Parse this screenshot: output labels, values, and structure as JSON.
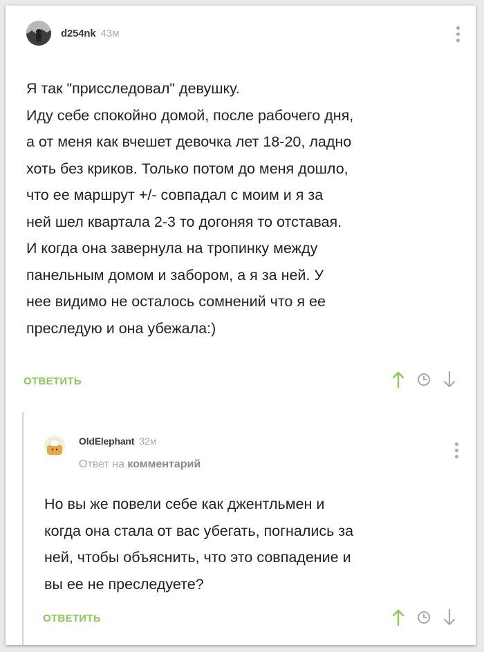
{
  "comments": [
    {
      "username": "d254nk",
      "time": "43м",
      "lines": [
        "Я так \"присследовал\" девушку.",
        "Иду себе спокойно домой, после рабочего дня,",
        "а от меня как вчешет девочка лет 18-20, ладно",
        "хоть без криков. Только потом до меня дошло,",
        "что ее маршрут +/- совпадал с моим и я за",
        "ней шел квартала 2-3 то догоняя то отставая.",
        "И когда она завернула на тропинку между",
        "панельным домом и забором, а я за ней. У",
        "нее видимо не осталось сомнений что я ее",
        "преследую и она убежала:)"
      ],
      "reply_label": "ОТВЕТИТЬ"
    },
    {
      "username": "OldElephant",
      "time": "32м",
      "reply_to_prefix": "Ответ на",
      "reply_to_link": "комментарий",
      "lines": [
        "Но вы же повели себе как джентльмен и",
        "когда она стала от вас убегать, погнались за",
        "ней, чтобы объяснить, что это совпадение и",
        "вы ее не преследуете?"
      ],
      "reply_label": "ОТВЕТИТЬ"
    }
  ],
  "colors": {
    "accent_green": "#8ac858",
    "icon_gray": "#a9a9a9",
    "thread_line": "#d2d2d2"
  },
  "icons": [
    "more-vertical-icon",
    "arrow-up-icon",
    "clock-icon",
    "arrow-down-icon"
  ]
}
